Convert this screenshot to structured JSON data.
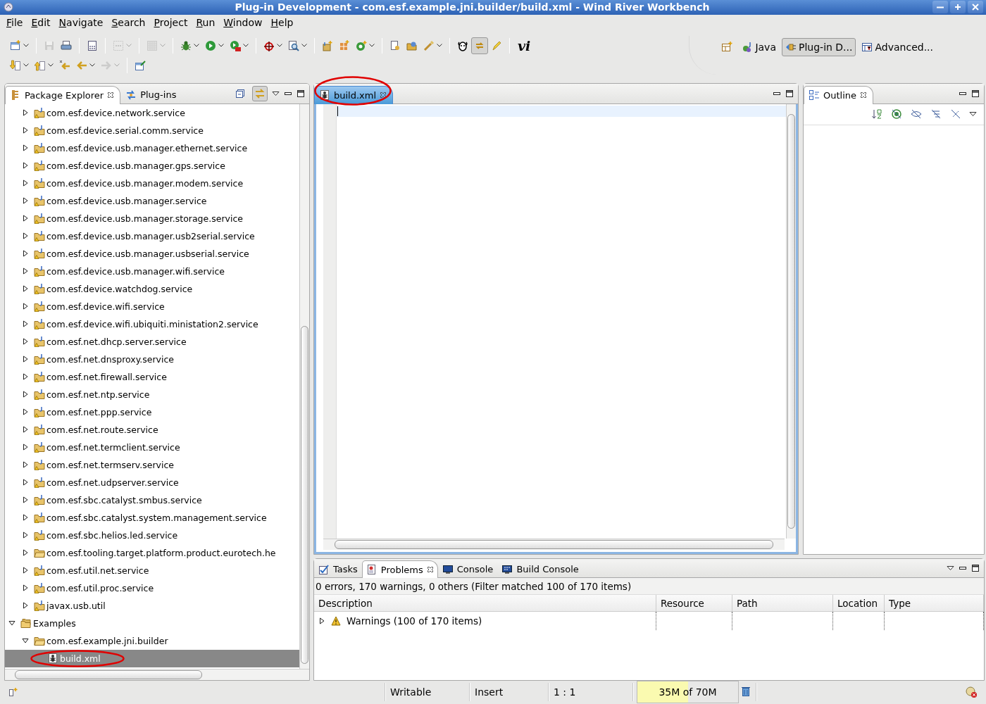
{
  "window": {
    "title": "Plug-in Development - com.esf.example.jni.builder/build.xml - Wind River Workbench"
  },
  "menu": [
    "File",
    "Edit",
    "Navigate",
    "Search",
    "Project",
    "Run",
    "Window",
    "Help"
  ],
  "toolbar": {
    "rows": [
      [
        {
          "kind": "button",
          "dropdown": true,
          "disabled": false,
          "pressed": false
        },
        {
          "kind": "separator"
        },
        {
          "kind": "button",
          "dropdown": false,
          "disabled": true,
          "pressed": false
        },
        {
          "kind": "button",
          "dropdown": false,
          "disabled": false,
          "pressed": false
        },
        {
          "kind": "separator"
        },
        {
          "kind": "button",
          "dropdown": false,
          "disabled": false,
          "pressed": false
        },
        {
          "kind": "separator"
        },
        {
          "kind": "button",
          "dropdown": true,
          "disabled": true,
          "pressed": false
        },
        {
          "kind": "separator"
        },
        {
          "kind": "button",
          "dropdown": true,
          "disabled": true,
          "pressed": false
        },
        {
          "kind": "separator"
        },
        {
          "kind": "button",
          "dropdown": true,
          "disabled": false,
          "pressed": false
        },
        {
          "kind": "button",
          "dropdown": true,
          "disabled": false,
          "pressed": false
        },
        {
          "kind": "button",
          "dropdown": true,
          "disabled": false,
          "pressed": false
        },
        {
          "kind": "separator"
        },
        {
          "kind": "button",
          "dropdown": true,
          "disabled": false,
          "pressed": false
        },
        {
          "kind": "button",
          "dropdown": true,
          "disabled": false,
          "pressed": false
        },
        {
          "kind": "separator"
        },
        {
          "kind": "button",
          "dropdown": false,
          "disabled": false,
          "pressed": false
        },
        {
          "kind": "button",
          "dropdown": false,
          "disabled": false,
          "pressed": false
        },
        {
          "kind": "button",
          "dropdown": true,
          "disabled": false,
          "pressed": false
        },
        {
          "kind": "separator"
        },
        {
          "kind": "button",
          "dropdown": false,
          "disabled": false,
          "pressed": false
        },
        {
          "kind": "button",
          "dropdown": false,
          "disabled": false,
          "pressed": false
        },
        {
          "kind": "button",
          "dropdown": true,
          "disabled": false,
          "pressed": false
        },
        {
          "kind": "separator"
        },
        {
          "kind": "button",
          "dropdown": false,
          "disabled": false,
          "pressed": false
        },
        {
          "kind": "button",
          "dropdown": false,
          "disabled": false,
          "pressed": true
        },
        {
          "kind": "button",
          "dropdown": false,
          "disabled": false,
          "pressed": false
        },
        {
          "kind": "separator"
        },
        {
          "kind": "text-button",
          "label": "vi"
        }
      ],
      [
        {
          "kind": "button",
          "dropdown": true,
          "disabled": false,
          "pressed": false
        },
        {
          "kind": "button",
          "dropdown": true,
          "disabled": false,
          "pressed": false
        },
        {
          "kind": "button",
          "dropdown": false,
          "disabled": false,
          "pressed": false
        },
        {
          "kind": "button",
          "dropdown": true,
          "disabled": false,
          "pressed": false
        },
        {
          "kind": "button",
          "dropdown": true,
          "disabled": true,
          "pressed": false
        },
        {
          "kind": "separator"
        },
        {
          "kind": "button",
          "dropdown": false,
          "disabled": false,
          "pressed": false
        }
      ]
    ]
  },
  "perspectives": [
    {
      "label": "Java",
      "selected": false
    },
    {
      "label": "Plug-in D...",
      "selected": true
    },
    {
      "label": "Advanced...",
      "selected": false
    }
  ],
  "explorer": {
    "tabs": [
      {
        "label": "Package Explorer",
        "selected": true
      },
      {
        "label": "Plug-ins",
        "selected": false
      }
    ],
    "link_with_editor": true,
    "tree": [
      {
        "kind": "hidden-parent",
        "children": [
          {
            "label": "com.esf.device.network.service",
            "kind": "plugin-project",
            "expanded": false,
            "selected": false,
            "circled": false
          },
          {
            "label": "com.esf.device.serial.comm.service",
            "kind": "plugin-project",
            "expanded": false,
            "selected": false,
            "circled": false
          },
          {
            "label": "com.esf.device.usb.manager.ethernet.service",
            "kind": "plugin-project",
            "expanded": false,
            "selected": false,
            "circled": false
          },
          {
            "label": "com.esf.device.usb.manager.gps.service",
            "kind": "plugin-project",
            "expanded": false,
            "selected": false,
            "circled": false
          },
          {
            "label": "com.esf.device.usb.manager.modem.service",
            "kind": "plugin-project",
            "expanded": false,
            "selected": false,
            "circled": false
          },
          {
            "label": "com.esf.device.usb.manager.service",
            "kind": "plugin-project",
            "expanded": false,
            "selected": false,
            "circled": false
          },
          {
            "label": "com.esf.device.usb.manager.storage.service",
            "kind": "plugin-project",
            "expanded": false,
            "selected": false,
            "circled": false
          },
          {
            "label": "com.esf.device.usb.manager.usb2serial.service",
            "kind": "plugin-project",
            "expanded": false,
            "selected": false,
            "circled": false
          },
          {
            "label": "com.esf.device.usb.manager.usbserial.service",
            "kind": "plugin-project",
            "expanded": false,
            "selected": false,
            "circled": false
          },
          {
            "label": "com.esf.device.usb.manager.wifi.service",
            "kind": "plugin-project",
            "expanded": false,
            "selected": false,
            "circled": false
          },
          {
            "label": "com.esf.device.watchdog.service",
            "kind": "plugin-project",
            "expanded": false,
            "selected": false,
            "circled": false
          },
          {
            "label": "com.esf.device.wifi.service",
            "kind": "plugin-project",
            "expanded": false,
            "selected": false,
            "circled": false
          },
          {
            "label": "com.esf.device.wifi.ubiquiti.ministation2.service",
            "kind": "plugin-project",
            "expanded": false,
            "selected": false,
            "circled": false
          },
          {
            "label": "com.esf.net.dhcp.server.service",
            "kind": "plugin-project",
            "expanded": false,
            "selected": false,
            "circled": false
          },
          {
            "label": "com.esf.net.dnsproxy.service",
            "kind": "plugin-project",
            "expanded": false,
            "selected": false,
            "circled": false
          },
          {
            "label": "com.esf.net.firewall.service",
            "kind": "plugin-project",
            "expanded": false,
            "selected": false,
            "circled": false
          },
          {
            "label": "com.esf.net.ntp.service",
            "kind": "plugin-project",
            "expanded": false,
            "selected": false,
            "circled": false
          },
          {
            "label": "com.esf.net.ppp.service",
            "kind": "plugin-project",
            "expanded": false,
            "selected": false,
            "circled": false
          },
          {
            "label": "com.esf.net.route.service",
            "kind": "plugin-project",
            "expanded": false,
            "selected": false,
            "circled": false
          },
          {
            "label": "com.esf.net.termclient.service",
            "kind": "plugin-project",
            "expanded": false,
            "selected": false,
            "circled": false
          },
          {
            "label": "com.esf.net.termserv.service",
            "kind": "plugin-project",
            "expanded": false,
            "selected": false,
            "circled": false
          },
          {
            "label": "com.esf.net.udpserver.service",
            "kind": "plugin-project",
            "expanded": false,
            "selected": false,
            "circled": false
          },
          {
            "label": "com.esf.sbc.catalyst.smbus.service",
            "kind": "plugin-project",
            "expanded": false,
            "selected": false,
            "circled": false
          },
          {
            "label": "com.esf.sbc.catalyst.system.management.service",
            "kind": "plugin-project",
            "expanded": false,
            "selected": false,
            "circled": false
          },
          {
            "label": "com.esf.sbc.helios.led.service",
            "kind": "plugin-project",
            "expanded": false,
            "selected": false,
            "circled": false
          },
          {
            "label": "com.esf.tooling.target.platform.product.eurotech.he",
            "kind": "project",
            "expanded": false,
            "selected": false,
            "circled": false
          },
          {
            "label": "com.esf.util.net.service",
            "kind": "plugin-project",
            "expanded": false,
            "selected": false,
            "circled": false
          },
          {
            "label": "com.esf.util.proc.service",
            "kind": "plugin-project",
            "expanded": false,
            "selected": false,
            "circled": false
          },
          {
            "label": "javax.usb.util",
            "kind": "plugin-project",
            "expanded": false,
            "selected": false,
            "circled": false
          }
        ]
      },
      {
        "label": "Examples",
        "kind": "working-set",
        "expanded": true,
        "selected": false,
        "circled": false,
        "children": [
          {
            "label": "com.esf.example.jni.builder",
            "kind": "project",
            "expanded": true,
            "selected": false,
            "circled": false,
            "children": [
              {
                "label": "build.xml",
                "kind": "ant-file",
                "selected": true,
                "circled": true
              }
            ]
          }
        ]
      }
    ]
  },
  "editor": {
    "tabs": [
      {
        "label": "build.xml",
        "selected": true,
        "circled": true
      }
    ]
  },
  "outline": {
    "tabs": [
      {
        "label": "Outline",
        "selected": true
      }
    ]
  },
  "bottom": {
    "tabs": [
      {
        "label": "Tasks",
        "selected": false
      },
      {
        "label": "Problems",
        "selected": true
      },
      {
        "label": "Console",
        "selected": false
      },
      {
        "label": "Build Console",
        "selected": false
      }
    ],
    "summary": "0 errors, 170 warnings, 0 others (Filter matched 100 of 170 items)",
    "columns": [
      "Description",
      "Resource",
      "Path",
      "Location",
      "Type"
    ],
    "rows": [
      {
        "description": "Warnings (100 of 170 items)",
        "expanded": false
      }
    ]
  },
  "status_bar": {
    "mode": "Writable",
    "insert": "Insert",
    "position": "1 : 1",
    "heap": {
      "text": "35M of 70M",
      "level": 0.5
    }
  }
}
